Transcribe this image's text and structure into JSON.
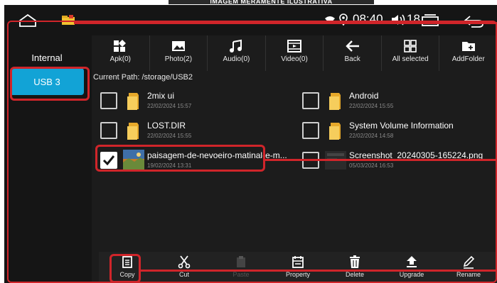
{
  "banner": {
    "text": "IMAGEM MERAMENTE ILUSTRATIVA"
  },
  "statusbar": {
    "time": "08:40",
    "volume": "18"
  },
  "sidebar": {
    "items": [
      {
        "label": "Internal"
      },
      {
        "label": "USB 3"
      }
    ]
  },
  "toolbar": {
    "items": [
      {
        "label": "Apk(0)",
        "icon": "apk-icon"
      },
      {
        "label": "Photo(2)",
        "icon": "photo-icon"
      },
      {
        "label": "Audio(0)",
        "icon": "music-icon"
      },
      {
        "label": "Video(0)",
        "icon": "video-icon"
      },
      {
        "label": "Back",
        "icon": "back-arrow-icon"
      },
      {
        "label": "All selected",
        "icon": "select-all-icon"
      },
      {
        "label": "AddFolder",
        "icon": "add-folder-icon"
      }
    ]
  },
  "path": {
    "text": "Current Path: /storage/USB2"
  },
  "files": [
    {
      "name": "2mix ui",
      "date": "22/02/2024 15:57",
      "type": "folder",
      "checked": false
    },
    {
      "name": "Android",
      "date": "22/02/2024 15:55",
      "type": "folder",
      "checked": false
    },
    {
      "name": "LOST.DIR",
      "date": "22/02/2024 15:55",
      "type": "folder",
      "checked": false
    },
    {
      "name": "System Volume Information",
      "date": "22/02/2024 14:58",
      "type": "folder",
      "checked": false
    },
    {
      "name": "paisagem-de-nevoeiro-matinal-e-m...",
      "date": "19/02/2024 13:31",
      "type": "image",
      "checked": true
    },
    {
      "name": "Screenshot_20240305-165224.png",
      "date": "05/03/2024 16:53",
      "type": "image",
      "checked": false
    }
  ],
  "bottombar": {
    "items": [
      {
        "label": "Copy",
        "icon": "copy-icon",
        "enabled": true
      },
      {
        "label": "Cut",
        "icon": "scissors-icon",
        "enabled": true
      },
      {
        "label": "Paste",
        "icon": "paste-icon",
        "enabled": false
      },
      {
        "label": "Property",
        "icon": "property-icon",
        "enabled": true
      },
      {
        "label": "Delete",
        "icon": "trash-icon",
        "enabled": true
      },
      {
        "label": "Upgrade",
        "icon": "upgrade-icon",
        "enabled": true
      },
      {
        "label": "Rename",
        "icon": "rename-icon",
        "enabled": true
      }
    ]
  },
  "colors": {
    "accent": "#12a3d6",
    "highlight": "#d0252a",
    "background": "#151515"
  }
}
